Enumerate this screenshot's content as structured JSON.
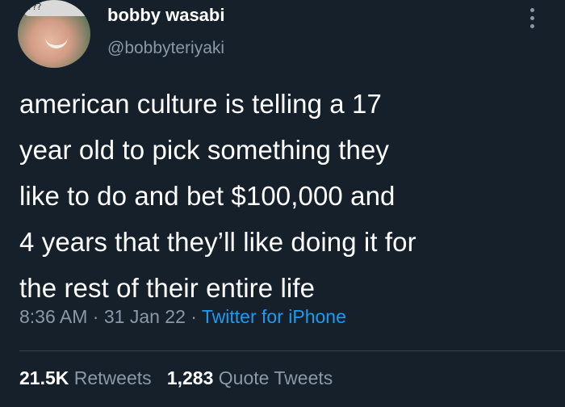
{
  "user": {
    "display_name": "bobby wasabi",
    "handle": "@bobbyteriyaki",
    "avatar_cap_text": "???"
  },
  "more_icon": "more-vertical-icon",
  "tweet": {
    "lines": [
      "american culture is telling a 17",
      "year old to pick something they",
      "like to do and bet $100,000 and",
      "4 years that they’ll like doing it for",
      "the rest of their entire life"
    ]
  },
  "meta": {
    "time": "8:36 AM",
    "sep1": " · ",
    "date": "31 Jan 22",
    "sep2": " · ",
    "source": "Twitter for iPhone"
  },
  "stats": {
    "retweets_count": "21.5K",
    "retweets_label": "Retweets",
    "quotes_count": "1,283",
    "quotes_label": "Quote Tweets"
  },
  "colors": {
    "background": "#15202b",
    "secondary_text": "#8b98a5",
    "link": "#1d9bf0",
    "divider": "#38444d"
  }
}
